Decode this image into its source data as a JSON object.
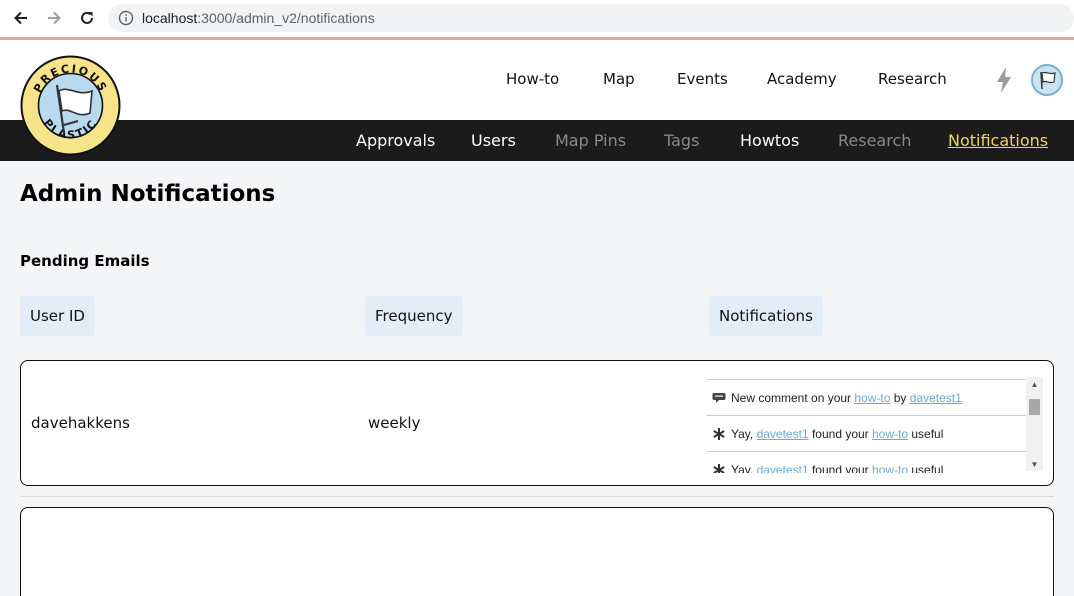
{
  "browser": {
    "url_host": "localhost",
    "url_path": ":3000/admin_v2/notifications",
    "back_icon": "arrow-left-icon",
    "forward_icon": "arrow-right-icon",
    "reload_icon": "reload-icon",
    "info_icon": "info-icon"
  },
  "header": {
    "logo_top": "PRECIOUS",
    "logo_bottom": "PLASTIC",
    "nav": [
      "How-to",
      "Map",
      "Events",
      "Academy",
      "Research"
    ],
    "bolt_icon": "lightning-icon",
    "avatar_icon": "flag-avatar-icon"
  },
  "admin_nav": {
    "items": [
      {
        "label": "Approvals",
        "state": "normal"
      },
      {
        "label": "Users",
        "state": "normal"
      },
      {
        "label": "Map Pins",
        "state": "dim"
      },
      {
        "label": "Tags",
        "state": "dim"
      },
      {
        "label": "Howtos",
        "state": "normal"
      },
      {
        "label": "Research",
        "state": "dim"
      },
      {
        "label": "Notifications",
        "state": "current"
      }
    ]
  },
  "main": {
    "title": "Admin Notifications",
    "section": "Pending Emails",
    "columns": [
      "User ID",
      "Frequency",
      "Notifications"
    ],
    "rows": [
      {
        "user_id": "davehakkens",
        "frequency": "weekly",
        "notifications": [
          {
            "icon": "comment-icon",
            "pre": "New comment on your ",
            "link1": "how-to",
            "mid": " by ",
            "link2": "davetest1",
            "post": ""
          },
          {
            "icon": "asterisk-icon",
            "pre": "Yay, ",
            "link1": "davetest1",
            "mid": " found your ",
            "link2": "how-to",
            "post": " useful"
          },
          {
            "icon": "asterisk-icon",
            "pre": "Yay, ",
            "link1": "davetest1",
            "mid": " found your ",
            "link2": "how-to",
            "post": " useful"
          }
        ]
      }
    ]
  },
  "colors": {
    "accent_yellow": "#f0d36a",
    "admin_bar": "#1b1b1b",
    "header_cell": "#e3edf7",
    "link": "#6aa9d8"
  }
}
